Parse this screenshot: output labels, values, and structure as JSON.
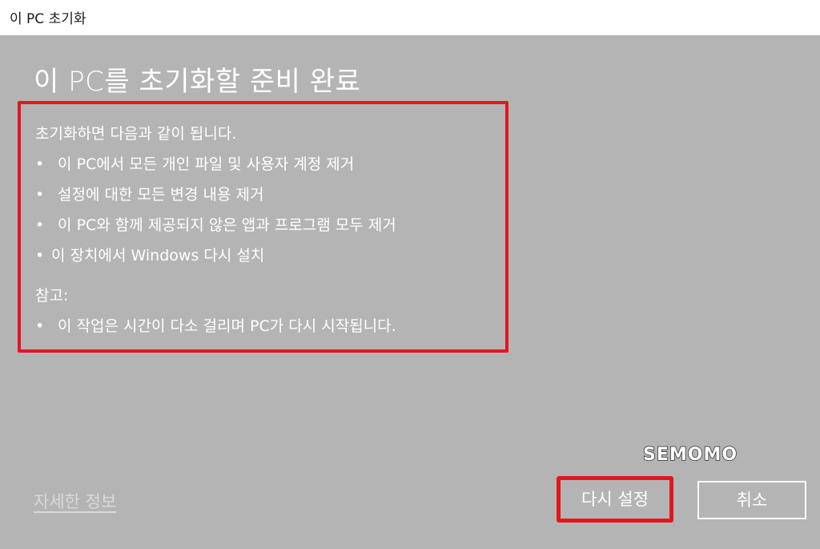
{
  "window": {
    "title": "이 PC 초기화"
  },
  "main": {
    "heading": "이 PC를 초기화할 준비 완료",
    "intro": "초기화하면 다음과 같이 됩니다.",
    "bullets": [
      "이 PC에서 모든 개인 파일 및 사용자 계정 제거",
      "설정에 대한 모든 변경 내용 제거",
      "이 PC와 함께 제공되지 않은 앱과 프로그램 모두 제거",
      "이 장치에서 Windows 다시 설치"
    ],
    "note_label": "참고:",
    "note_bullets": [
      "이 작업은 시간이 다소 걸리며 PC가 다시 시작됩니다."
    ],
    "bullet_char": "•"
  },
  "footer": {
    "more_info_link": "자세한 정보",
    "reset_button": "다시 설정",
    "cancel_button": "취소"
  },
  "watermark": "SEMOMO",
  "colors": {
    "background": "#b4b4b4",
    "highlight": "#e3161f",
    "text": "#ffffff"
  }
}
